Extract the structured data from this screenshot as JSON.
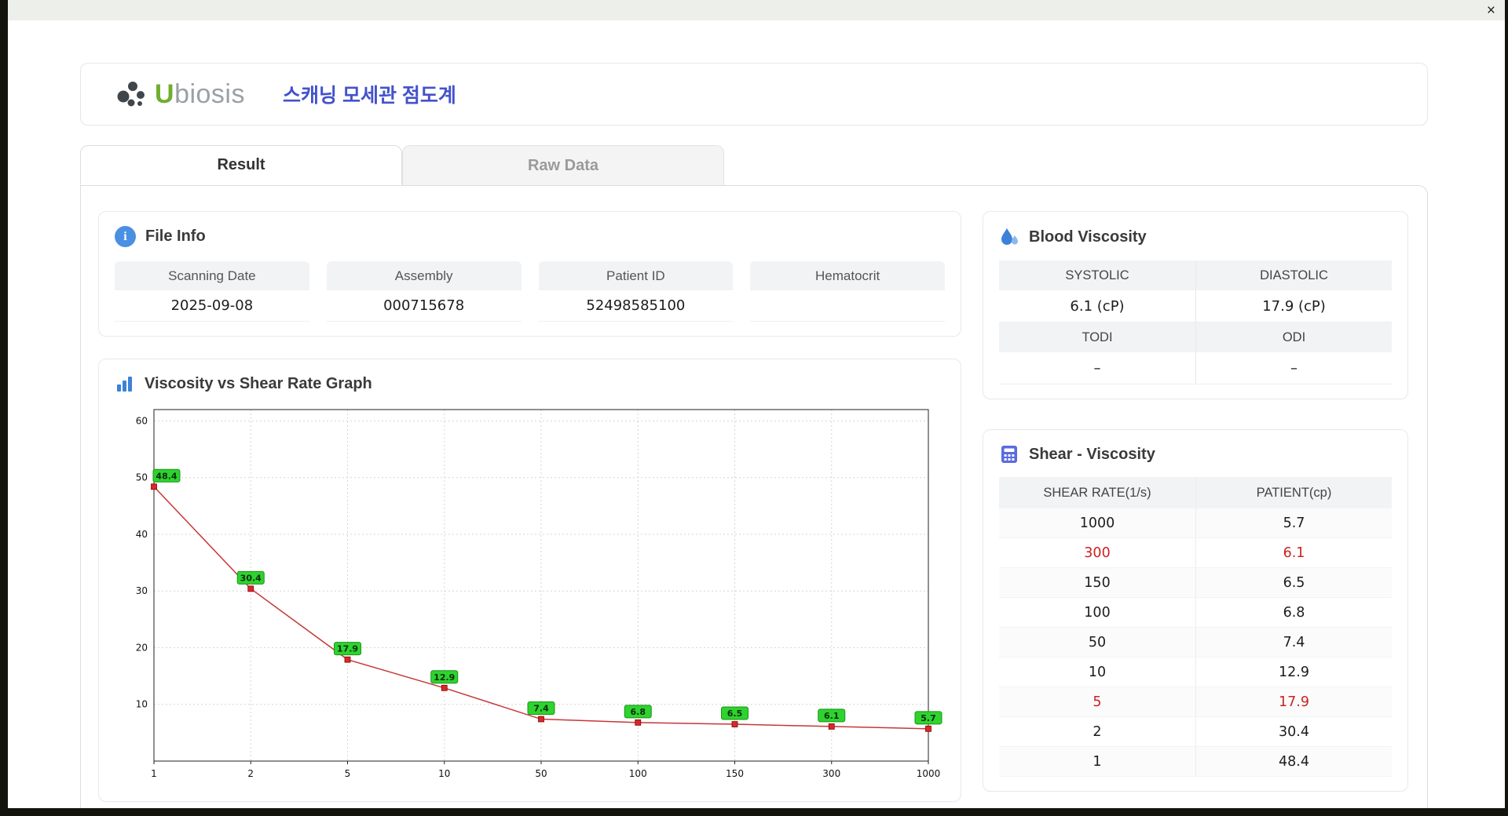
{
  "window": {
    "close_label": "×"
  },
  "header": {
    "logo_u": "U",
    "logo_rest": "biosis",
    "title": "스캐닝 모세관 점도계"
  },
  "tabs": {
    "result": "Result",
    "raw_data": "Raw Data"
  },
  "file_info": {
    "title": "File Info",
    "fields": [
      {
        "label": "Scanning Date",
        "value": "2025-09-08"
      },
      {
        "label": "Assembly",
        "value": "000715678"
      },
      {
        "label": "Patient ID",
        "value": "52498585100"
      },
      {
        "label": "Hematocrit",
        "value": ""
      }
    ]
  },
  "blood_viscosity": {
    "title": "Blood Viscosity",
    "row1": {
      "col1_label": "SYSTOLIC",
      "col2_label": "DIASTOLIC",
      "col1_value": "6.1 (cP)",
      "col2_value": "17.9 (cP)"
    },
    "row2": {
      "col1_label": "TODI",
      "col2_label": "ODI",
      "col1_value": "–",
      "col2_value": "–"
    }
  },
  "shear_viscosity": {
    "title": "Shear - Viscosity",
    "headers": {
      "rate": "SHEAR RATE(1/s)",
      "patient": "PATIENT(cp)"
    },
    "rows": [
      {
        "rate": "1000",
        "patient": "5.7",
        "highlight": false
      },
      {
        "rate": "300",
        "patient": "6.1",
        "highlight": true
      },
      {
        "rate": "150",
        "patient": "6.5",
        "highlight": false
      },
      {
        "rate": "100",
        "patient": "6.8",
        "highlight": false
      },
      {
        "rate": "50",
        "patient": "7.4",
        "highlight": false
      },
      {
        "rate": "10",
        "patient": "12.9",
        "highlight": false
      },
      {
        "rate": "5",
        "patient": "17.9",
        "highlight": true
      },
      {
        "rate": "2",
        "patient": "30.4",
        "highlight": false
      },
      {
        "rate": "1",
        "patient": "48.4",
        "highlight": false
      }
    ]
  },
  "graph": {
    "title": "Viscosity vs Shear Rate Graph"
  },
  "chart_data": {
    "type": "line",
    "title": "Viscosity vs Shear Rate Graph",
    "x_labels": [
      "1",
      "2",
      "5",
      "10",
      "50",
      "100",
      "150",
      "300",
      "1000"
    ],
    "values": [
      48.4,
      30.4,
      17.9,
      12.9,
      7.4,
      6.8,
      6.5,
      6.1,
      5.7
    ],
    "yticks": [
      10,
      20,
      30,
      40,
      50,
      60
    ],
    "ylim": [
      0,
      62
    ],
    "xlabel": "",
    "ylabel": "",
    "grid": true,
    "legend_position": "none",
    "line_color": "#c73737",
    "marker_color": "#d42a2a",
    "point_label_bg": "#2fd32f",
    "point_label_border": "#169416"
  }
}
